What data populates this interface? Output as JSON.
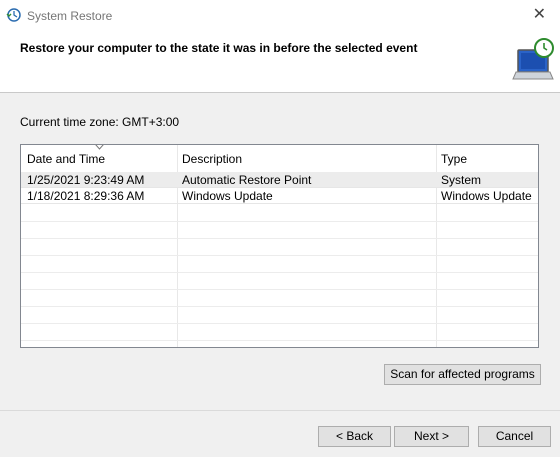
{
  "window": {
    "title": "System Restore",
    "close_glyph": "✕",
    "icons": {
      "app": "system-restore-icon",
      "header": "computer-restore-icon",
      "close": "close-icon"
    }
  },
  "header": {
    "heading": "Restore your computer to the state it was in before the selected event"
  },
  "timezone_label": "Current time zone: GMT+3:00",
  "table": {
    "columns": [
      "Date and Time",
      "Description",
      "Type"
    ],
    "sorted_column": "Date and Time",
    "rows": [
      {
        "date": "1/25/2021 9:23:49 AM",
        "description": "Automatic Restore Point",
        "type": "System",
        "selected": true
      },
      {
        "date": "1/18/2021 8:29:36 AM",
        "description": "Windows Update",
        "type": "Windows Update",
        "selected": false
      }
    ]
  },
  "buttons": {
    "scan": "Scan for affected programs",
    "back": "< Back",
    "next": "Next >",
    "cancel": "Cancel"
  },
  "colors": {
    "window_bg": "#f0f0f0",
    "header_bg": "#ffffff",
    "selected_row": "#ececec",
    "button_bg": "#e1e1e1",
    "button_border": "#adadad"
  }
}
